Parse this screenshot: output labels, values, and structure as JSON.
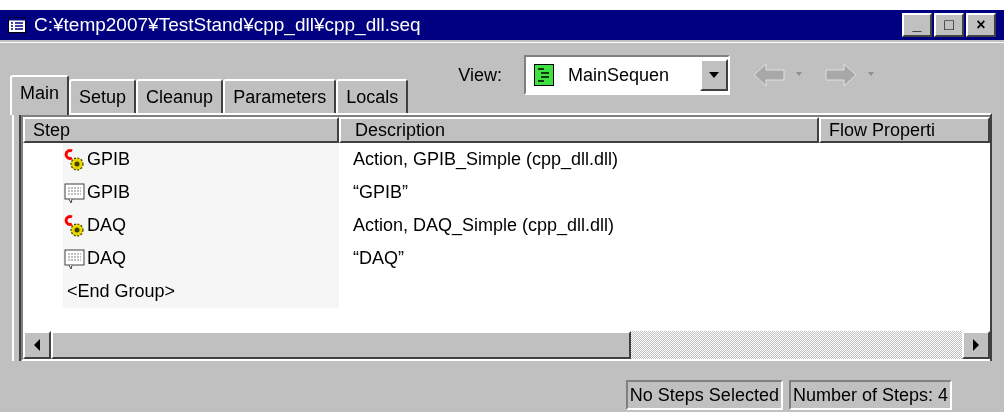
{
  "window": {
    "title": "C:¥temp2007¥TestStand¥cpp_dll¥cpp_dll.seq",
    "controls": [
      "_",
      "□",
      "×"
    ]
  },
  "tabs": [
    {
      "label": "Main",
      "selected": true
    },
    {
      "label": "Setup",
      "selected": false
    },
    {
      "label": "Cleanup",
      "selected": false
    },
    {
      "label": "Parameters",
      "selected": false
    },
    {
      "label": "Locals",
      "selected": false
    }
  ],
  "view": {
    "label": "View:",
    "value": "MainSequen"
  },
  "table": {
    "columns": [
      "Step",
      "Description",
      "Flow Properti"
    ],
    "rows": [
      {
        "kind": "action",
        "step": "GPIB",
        "description": "Action,  GPIB_Simple (cpp_dll.dll)"
      },
      {
        "kind": "message",
        "step": "GPIB",
        "description": "“GPIB”"
      },
      {
        "kind": "action",
        "step": "DAQ",
        "description": "Action,  DAQ_Simple (cpp_dll.dll)"
      },
      {
        "kind": "message",
        "step": "DAQ",
        "description": "“DAQ”"
      },
      {
        "kind": "end",
        "step": "<End Group>",
        "description": ""
      }
    ]
  },
  "status_bar": [
    "No Steps Selected",
    "Number of Steps: 4"
  ]
}
